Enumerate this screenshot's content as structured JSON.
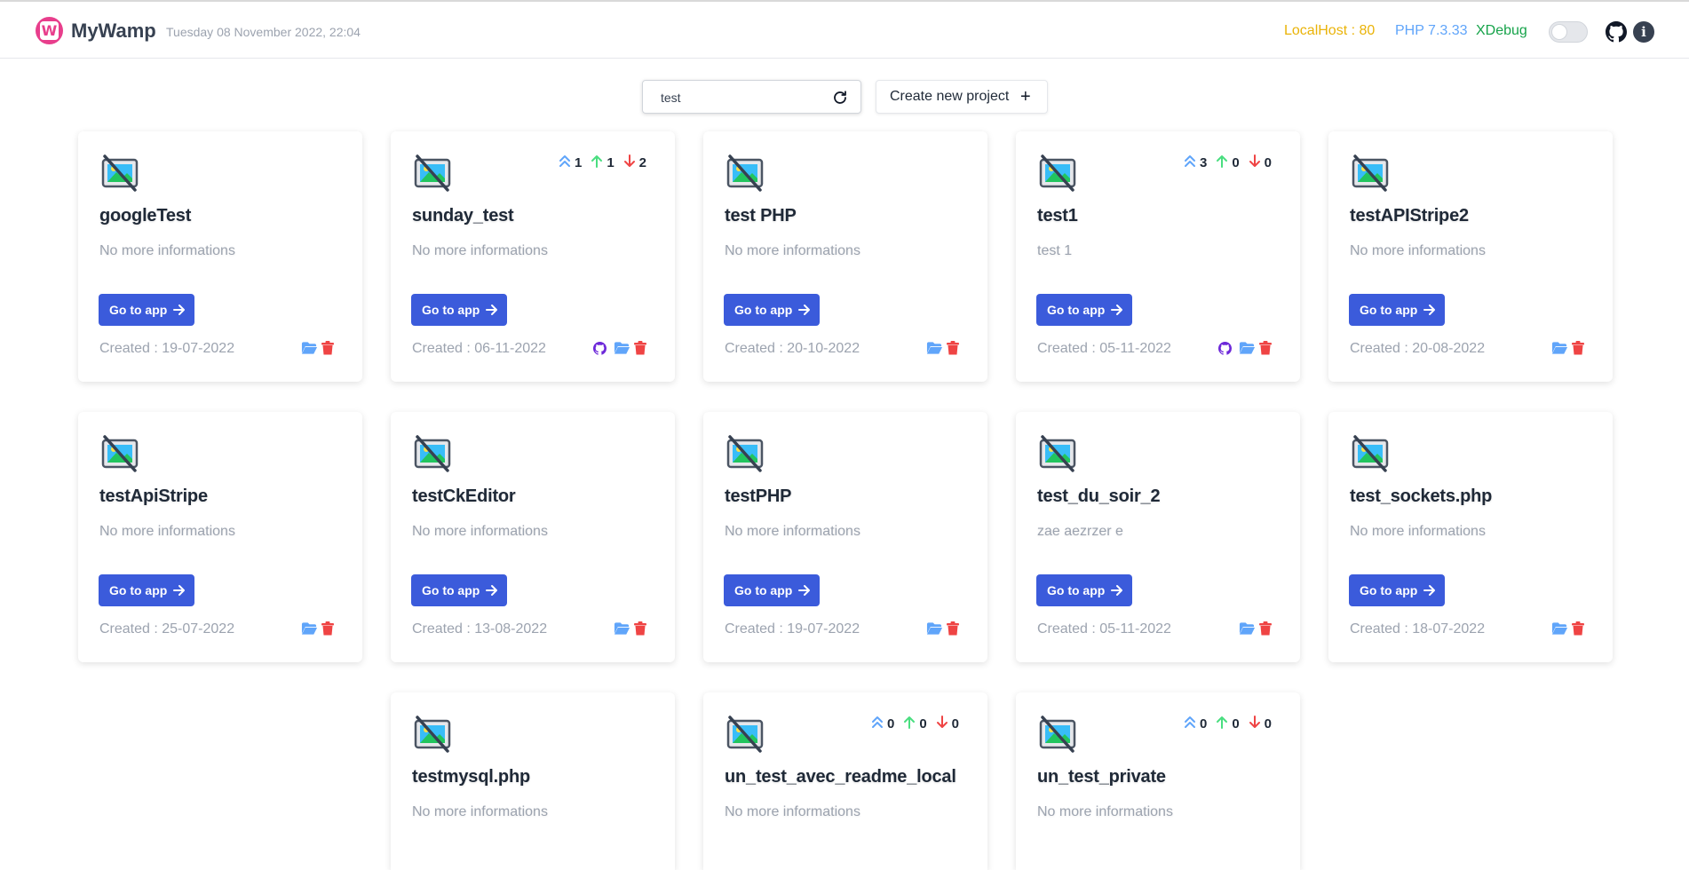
{
  "header": {
    "app_title": "MyWamp",
    "date": "Tuesday 08 November 2022, 22:04",
    "localhost": "LocalHost : 80",
    "php": "PHP 7.3.33",
    "xdebug": "XDebug",
    "toggle_state": "off"
  },
  "search": {
    "value": "test",
    "placeholder": ""
  },
  "create_button_label": "Create new project",
  "go_label": "Go to app",
  "colors": {
    "accent": "#3b5bdb",
    "localhost": "#eab308",
    "php": "#60a5fa",
    "xdebug": "#16a34a",
    "folder": "#60a5fa",
    "trash": "#ef4444",
    "github": "#6d28d9",
    "arrow_up": "#4ade80",
    "arrow_down": "#ef4444"
  },
  "projects": [
    {
      "name": "googleTest",
      "desc": "No more informations",
      "created": "Created : 19-07-2022",
      "stats": null,
      "github": false
    },
    {
      "name": "sunday_test",
      "desc": "No more informations",
      "created": "Created : 06-11-2022",
      "stats": {
        "ahead": "1",
        "up": "1",
        "down": "2"
      },
      "github": true
    },
    {
      "name": "test PHP",
      "desc": "No more informations",
      "created": "Created : 20-10-2022",
      "stats": null,
      "github": false
    },
    {
      "name": "test1",
      "desc": "test 1",
      "created": "Created : 05-11-2022",
      "stats": {
        "ahead": "3",
        "up": "0",
        "down": "0"
      },
      "github": true
    },
    {
      "name": "testAPIStripe2",
      "desc": "No more informations",
      "created": "Created : 20-08-2022",
      "stats": null,
      "github": false
    },
    {
      "name": "testApiStripe",
      "desc": "No more informations",
      "created": "Created : 25-07-2022",
      "stats": null,
      "github": false
    },
    {
      "name": "testCkEditor",
      "desc": "No more informations",
      "created": "Created : 13-08-2022",
      "stats": null,
      "github": false
    },
    {
      "name": "testPHP",
      "desc": "No more informations",
      "created": "Created : 19-07-2022",
      "stats": null,
      "github": false
    },
    {
      "name": "test_du_soir_2",
      "desc": "zae aezrzer e",
      "created": "Created : 05-11-2022",
      "stats": null,
      "github": false
    },
    {
      "name": "test_sockets.php",
      "desc": "No more informations",
      "created": "Created : 18-07-2022",
      "stats": null,
      "github": false
    },
    {
      "name": "testmysql.php",
      "desc": "No more informations",
      "created": "",
      "stats": null,
      "github": false
    },
    {
      "name": "un_test_avec_readme_local",
      "desc": "No more informations",
      "created": "",
      "stats": {
        "ahead": "0",
        "up": "0",
        "down": "0"
      },
      "github": false
    },
    {
      "name": "un_test_private",
      "desc": "No more informations",
      "created": "",
      "stats": {
        "ahead": "0",
        "up": "0",
        "down": "0"
      },
      "github": false
    }
  ]
}
